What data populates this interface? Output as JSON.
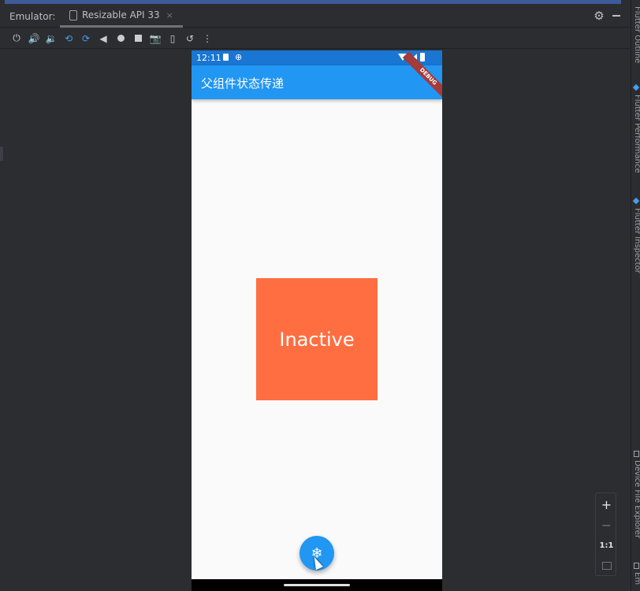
{
  "window": {
    "label": "Emulator:",
    "tab": {
      "title": "Resizable API 33",
      "close": "×"
    }
  },
  "toolbar": {
    "icons": [
      "power-icon",
      "volume-up-icon",
      "volume-down-icon",
      "rotate-left-icon",
      "rotate-right-icon",
      "back-icon",
      "home-icon",
      "overview-icon",
      "screenshot-icon",
      "fold-icon",
      "snapshot-icon",
      "more-icon"
    ]
  },
  "right_panel": {
    "labels": [
      "Flutter Outline",
      "Flutter Performance",
      "Flutter Inspector",
      "Device File Explorer",
      "Em"
    ]
  },
  "device": {
    "status_bar": {
      "time": "12:11"
    },
    "app_bar": {
      "title": "父组件状态传递",
      "banner": "DEBUG"
    },
    "box": {
      "label": "Inactive",
      "color": "#ff6e40"
    },
    "fab": {
      "icon": "snowflake-icon",
      "glyph": "❄"
    }
  },
  "zoom": {
    "zoom_in": "+",
    "zoom_out": "−",
    "actual_size": "1:1"
  },
  "colors": {
    "app_bar": "#2196f3",
    "status_bar": "#1976d2",
    "ide_background": "#2b2d30"
  }
}
